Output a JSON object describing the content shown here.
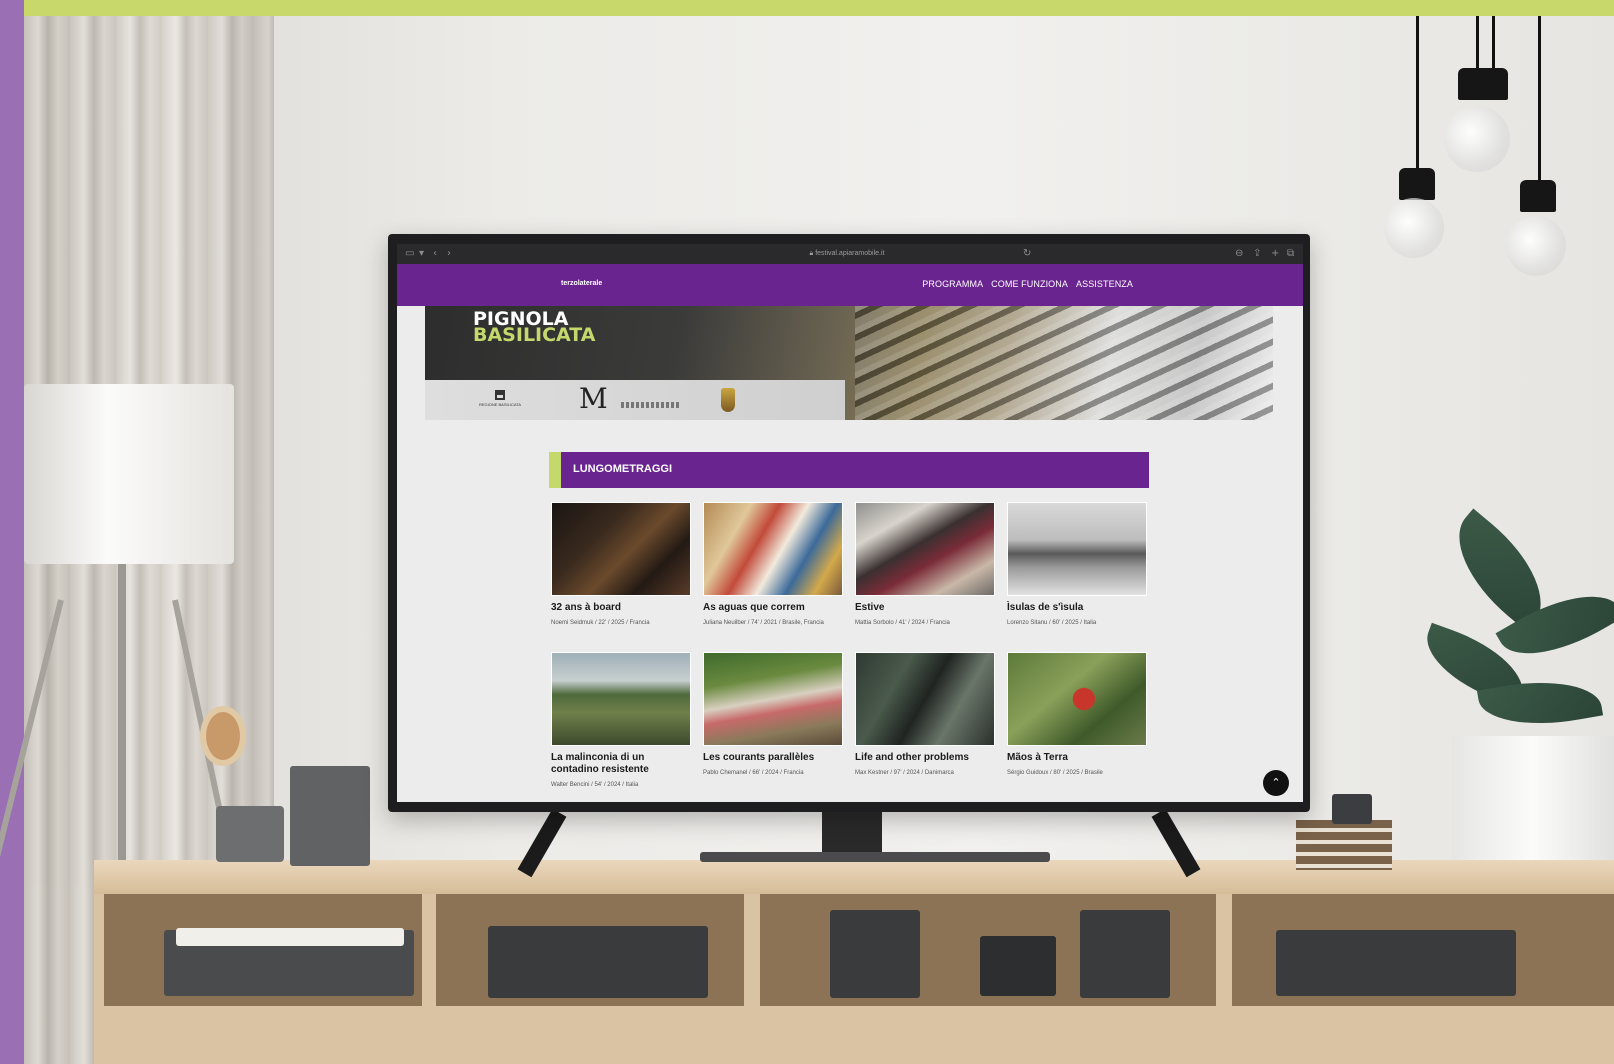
{
  "browser": {
    "url": "festival.apiaramobile.it",
    "icons": [
      "sidebar-icon",
      "back-icon",
      "forward-icon",
      "reload-icon",
      "share-icon",
      "new-tab-icon",
      "tabs-icon"
    ]
  },
  "site": {
    "logo": "terzolaterale",
    "nav": [
      "PROGRAMMA",
      "COME FUNZIONA",
      "ASSISTENZA"
    ],
    "brand_purple": "#6a2490",
    "brand_green": "#c4d86c"
  },
  "hero": {
    "title_line1": "PIGNOLA",
    "title_line2": "BASILICATA",
    "region_logo_text": "REGIONE BASILICATA",
    "ml_logo": "M"
  },
  "section": {
    "title": "LUNGOMETRAGGI"
  },
  "films": [
    {
      "title": "32 ans à board",
      "meta": "Noemi Seidmuk / 22' / 2025 / Francia"
    },
    {
      "title": "As aguas que correm",
      "meta": "Juliana Neuilber / 74' / 2021 / Brasile, Francia"
    },
    {
      "title": "Estive",
      "meta": "Mattia Sorbolo / 41' / 2024 / Francia"
    },
    {
      "title": "Ìsulas de s'ìsula",
      "meta": "Lorenzo Sitanu / 60' / 2025 / Italia"
    },
    {
      "title": "La malinconia di un contadino resistente",
      "meta": "Walter Bencini / 54' / 2024 / Italia"
    },
    {
      "title": "Les courants parallèles",
      "meta": "Pablo Chemanel / 66' / 2024 / Francia"
    },
    {
      "title": "Life and other problems",
      "meta": "Max Kestner / 97' / 2024 / Danimarca"
    },
    {
      "title": "Mãos à Terra",
      "meta": "Sérgio Guidoux / 80' / 2025 / Brasile"
    }
  ],
  "back_to_top": "⌃"
}
